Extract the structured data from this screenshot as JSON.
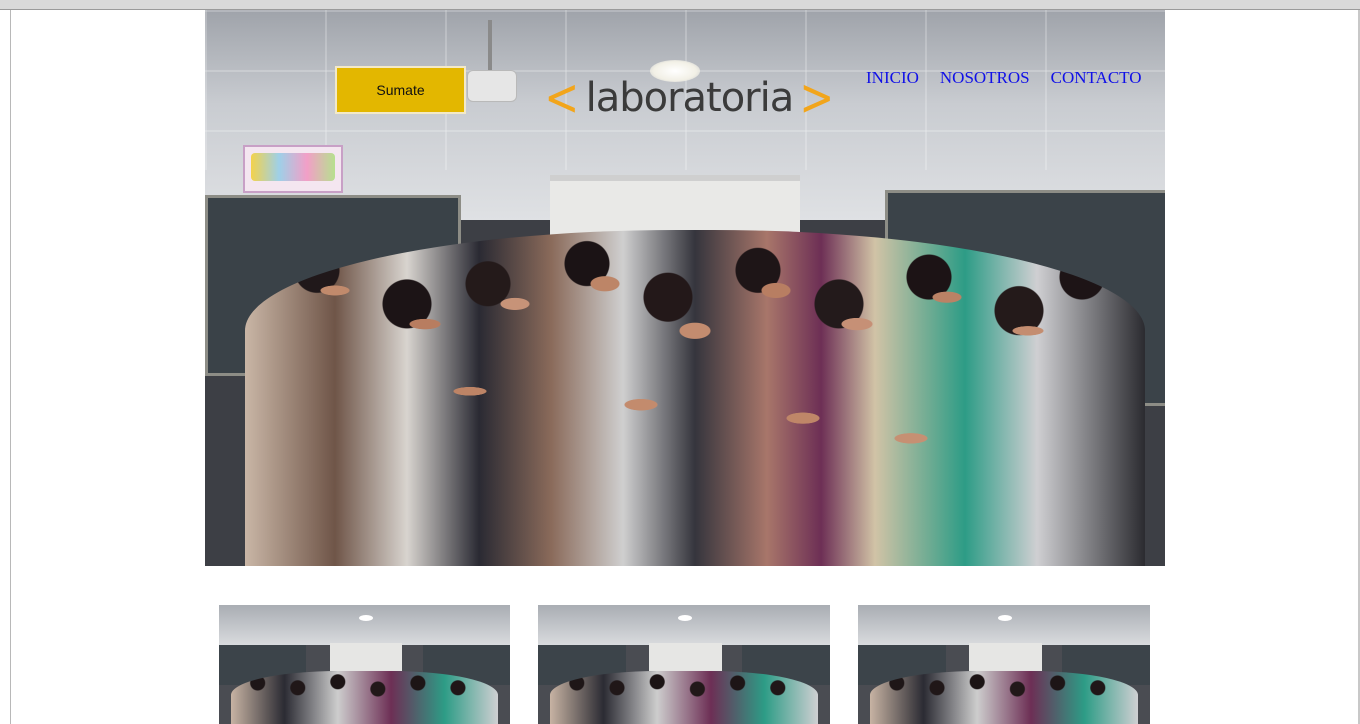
{
  "header": {
    "join_button_label": "Sumate",
    "logo": {
      "open_bracket": "<",
      "wordmark": "laboratoria",
      "close_bracket": ">"
    },
    "nav": [
      {
        "label": "INICIO"
      },
      {
        "label": "NOSOTROS"
      },
      {
        "label": "CONTACTO"
      }
    ]
  },
  "colors": {
    "button_bg": "#e3b700",
    "logo_accent": "#f2a51b",
    "nav_link": "#1010e8"
  },
  "hero": {
    "image": "group-photo"
  },
  "thumbnails": [
    {
      "image": "group-photo"
    },
    {
      "image": "group-photo"
    },
    {
      "image": "group-photo"
    }
  ]
}
